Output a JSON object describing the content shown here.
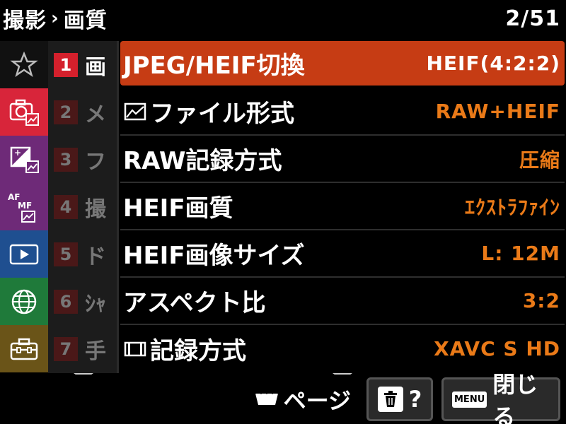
{
  "header": {
    "breadcrumb_parent": "撮影",
    "breadcrumb_sep": "›",
    "breadcrumb_current": "画質",
    "page_indicator": "2/51"
  },
  "categories": [
    {
      "icon": "star-icon",
      "color": "#111111"
    },
    {
      "icon": "camera-icon",
      "color": "#d8253a"
    },
    {
      "icon": "exposure-icon",
      "color": "#6e2a78"
    },
    {
      "icon": "af-mf-icon",
      "color": "#6e2a78",
      "text": "AF MF"
    },
    {
      "icon": "playback-icon",
      "color": "#1f4f90"
    },
    {
      "icon": "network-icon",
      "color": "#1f7a3a"
    },
    {
      "icon": "toolbox-icon",
      "color": "#6a5418"
    }
  ],
  "subtabs": [
    {
      "num": "1",
      "char": "画",
      "active": true
    },
    {
      "num": "2",
      "char": "メ",
      "active": false
    },
    {
      "num": "3",
      "char": "フ",
      "active": false
    },
    {
      "num": "4",
      "char": "撮",
      "active": false
    },
    {
      "num": "5",
      "char": "ド",
      "active": false
    },
    {
      "num": "6",
      "char": "ｼｬ",
      "active": false
    },
    {
      "num": "7",
      "char": "手",
      "active": false
    }
  ],
  "rows": [
    {
      "label": "JPEG/HEIF切換",
      "value": "HEIF(4:2:2)",
      "icon": ""
    },
    {
      "label": "ファイル形式",
      "value": "RAW+HEIF",
      "icon": "still-image-icon"
    },
    {
      "label": "RAW記録方式",
      "value": "圧縮",
      "icon": ""
    },
    {
      "label": "HEIF画質",
      "value": "ｴｸｽﾄﾗﾌｧｲﾝ",
      "icon": ""
    },
    {
      "label": "HEIF画像サイズ",
      "value": "L: 12M",
      "icon": ""
    },
    {
      "label": "アスペクト比",
      "value": "3:2",
      "icon": ""
    },
    {
      "label": "記録方式",
      "value": "XAVC S HD",
      "icon": "movie-icon"
    }
  ],
  "footer": {
    "page_label": "ページ",
    "help_label": "?",
    "menu_badge": "MENU",
    "close_label": "閉じる"
  },
  "colors": {
    "selected_row": "#c63c14",
    "value_text": "#ea7a18",
    "active_tab": "#d4202c"
  }
}
